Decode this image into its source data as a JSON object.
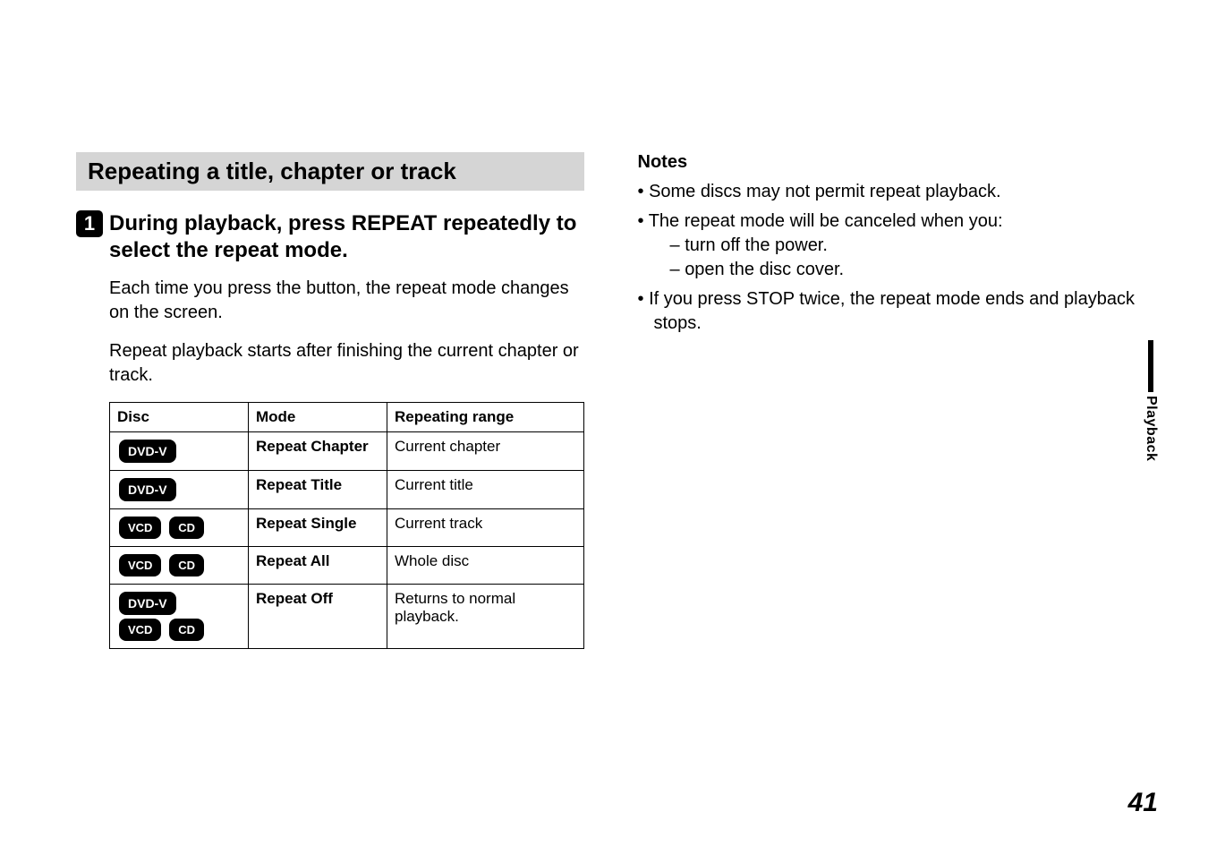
{
  "section_heading": "Repeating a title, chapter or track",
  "step": {
    "number": "1",
    "title": "During playback, press REPEAT repeatedly to select the repeat mode.",
    "para1": "Each time you press the button, the repeat mode changes on the screen.",
    "para2": "Repeat playback starts after finishing the current chapter or track."
  },
  "table": {
    "headers": {
      "disc": "Disc",
      "mode": "Mode",
      "range": "Repeating range"
    },
    "rows": [
      {
        "discs": [
          "DVD-V"
        ],
        "mode": "Repeat Chapter",
        "range": "Current chapter"
      },
      {
        "discs": [
          "DVD-V"
        ],
        "mode": "Repeat Title",
        "range": "Current title"
      },
      {
        "discs": [
          "VCD",
          "CD"
        ],
        "mode": "Repeat Single",
        "range": "Current track"
      },
      {
        "discs": [
          "VCD",
          "CD"
        ],
        "mode": "Repeat All",
        "range": "Whole disc"
      },
      {
        "discs": [
          "DVD-V",
          "VCD",
          "CD"
        ],
        "mode": "Repeat Off",
        "range": "Returns to normal playback."
      }
    ]
  },
  "notes": {
    "heading": "Notes",
    "items": [
      {
        "text": "Some discs may not permit repeat playback."
      },
      {
        "text": "The repeat mode will be canceled when you:",
        "sub": [
          "turn off the power.",
          "open the disc cover."
        ]
      },
      {
        "text": "If you press STOP twice, the repeat mode ends and playback stops."
      }
    ]
  },
  "side_tab": "Playback",
  "page_number": "41"
}
